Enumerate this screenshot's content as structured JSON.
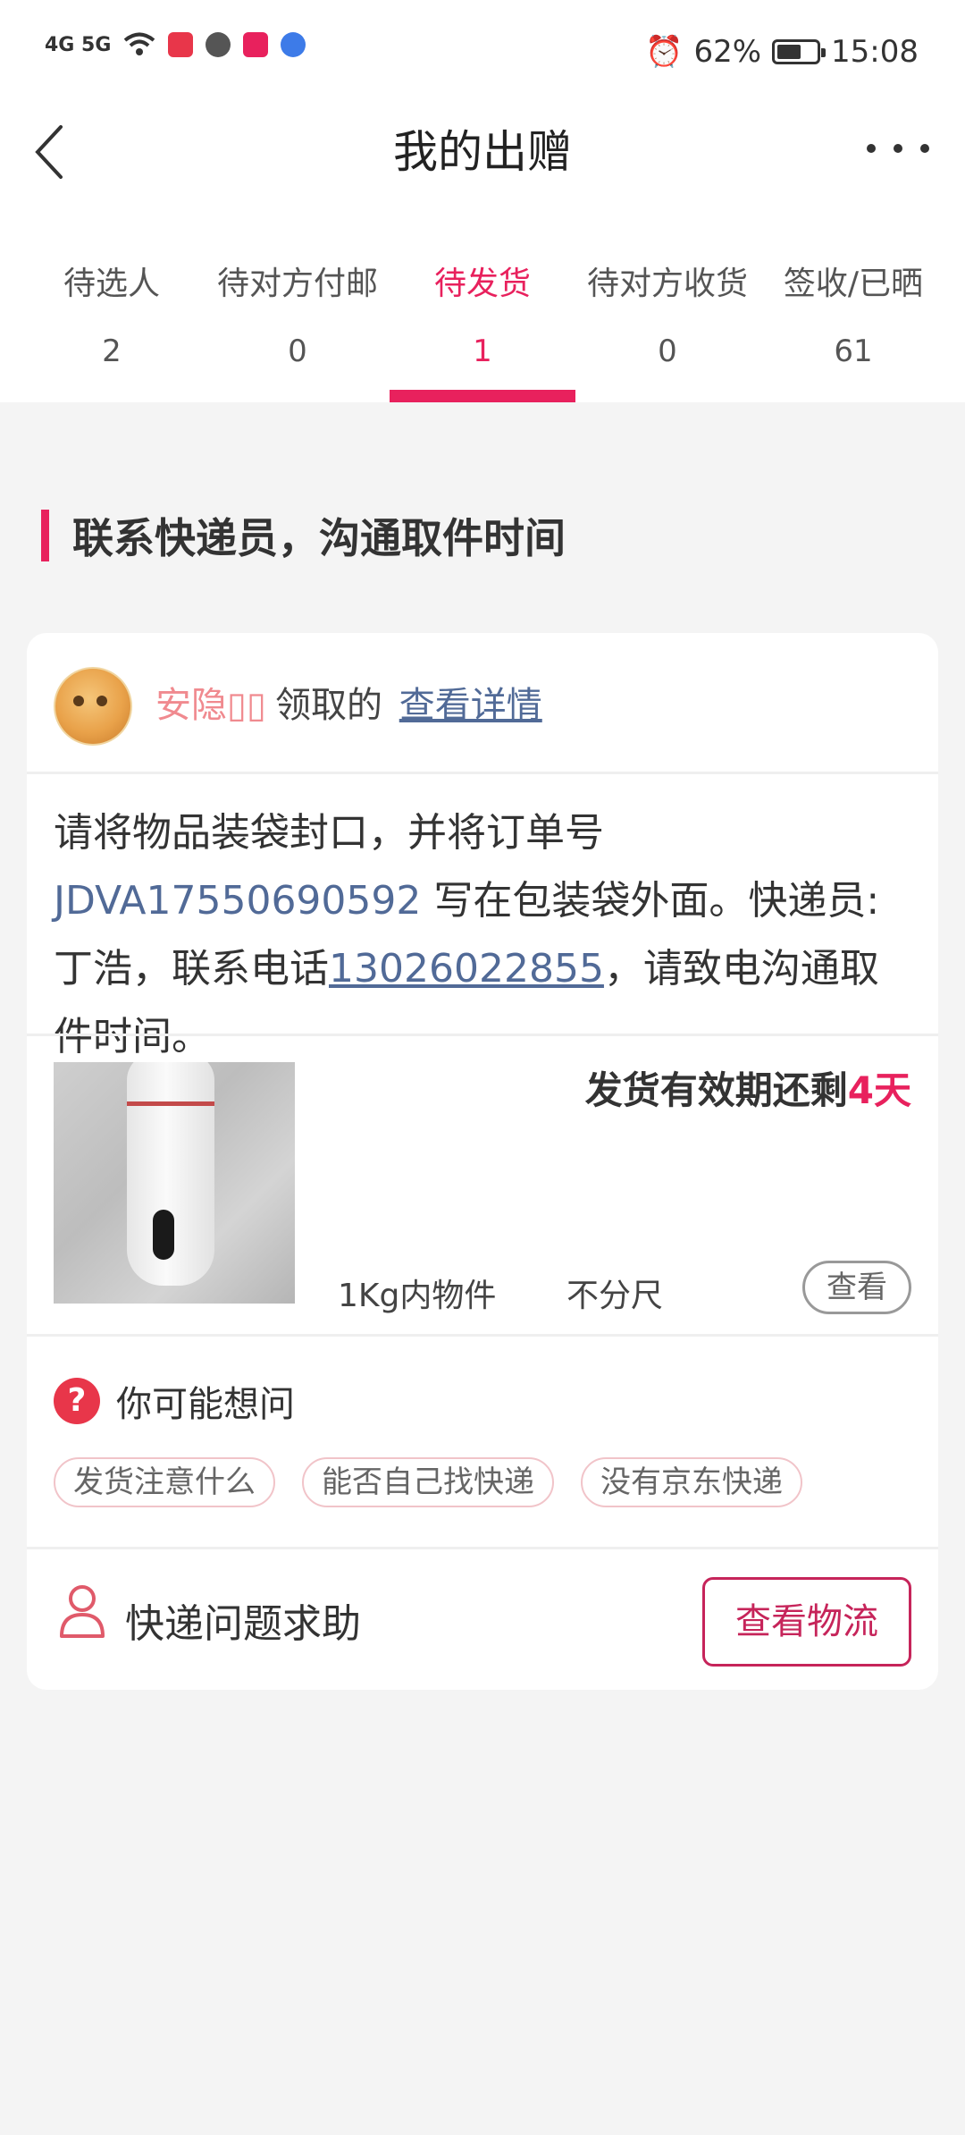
{
  "status_bar": {
    "network": "4G 5G",
    "alarm": "⏰",
    "battery": "62%",
    "battery_level": 0.62,
    "time": "15:08"
  },
  "header": {
    "title": "我的出赠"
  },
  "tabs": [
    {
      "label": "待选人",
      "count": "2"
    },
    {
      "label": "待对方付邮",
      "count": "0"
    },
    {
      "label": "待发货",
      "count": "1",
      "active": true
    },
    {
      "label": "待对方收货",
      "count": "0"
    },
    {
      "label": "签收/已晒",
      "count": "61"
    }
  ],
  "section": {
    "title": "联系快递员，沟通取件时间"
  },
  "card": {
    "user_name": "安隐▯▯",
    "claimed_text": "领取的",
    "detail_link": "查看详情",
    "instruction": {
      "part1": "请将物品装袋封口，并将订单号 ",
      "order_no": "JDVA17550690592",
      "part2": " 写在包装袋外面。快递员:丁浩，联系电话",
      "phone": "13026022855",
      "part3": "，请致电沟通取件时间。"
    },
    "deadline_prefix": "发货有效期还剩",
    "deadline_days": "4天",
    "weight": "1Kg内物件",
    "size": "不分尺",
    "view_button": "查看",
    "faq_title": "你可能想问",
    "faq_chips": [
      "发货注意什么",
      "能否自己找快递",
      "没有京东快递"
    ],
    "help_text": "快递问题求助",
    "logistics_button": "查看物流"
  },
  "colors": {
    "accent": "#e8215d",
    "link": "#516a97",
    "background": "#f4f4f4"
  }
}
